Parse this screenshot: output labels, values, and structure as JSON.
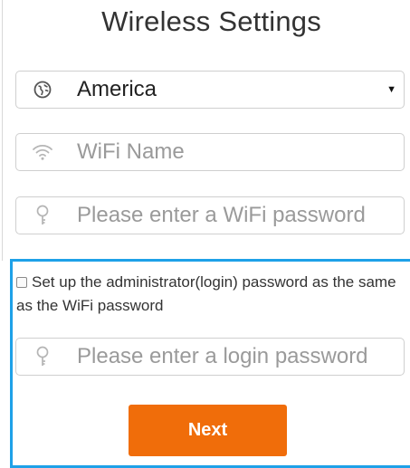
{
  "title": "Wireless Settings",
  "region": {
    "selected": "America",
    "icon": "globe-icon"
  },
  "wifi_name": {
    "placeholder": "WiFi Name",
    "icon": "wifi-icon"
  },
  "wifi_password": {
    "placeholder": "Please enter a WiFi password",
    "icon": "key-icon"
  },
  "admin": {
    "checkbox_label": "Set up the administrator(login) password as the same as the WiFi password",
    "checked": false,
    "login_password_placeholder": "Please enter a login password",
    "icon": "key-icon"
  },
  "next_button_label": "Next",
  "colors": {
    "accent_button": "#f06d0a",
    "highlight_border": "#1ea1e8",
    "field_border": "#cfcfcf",
    "placeholder_text": "#9a9a9a"
  }
}
